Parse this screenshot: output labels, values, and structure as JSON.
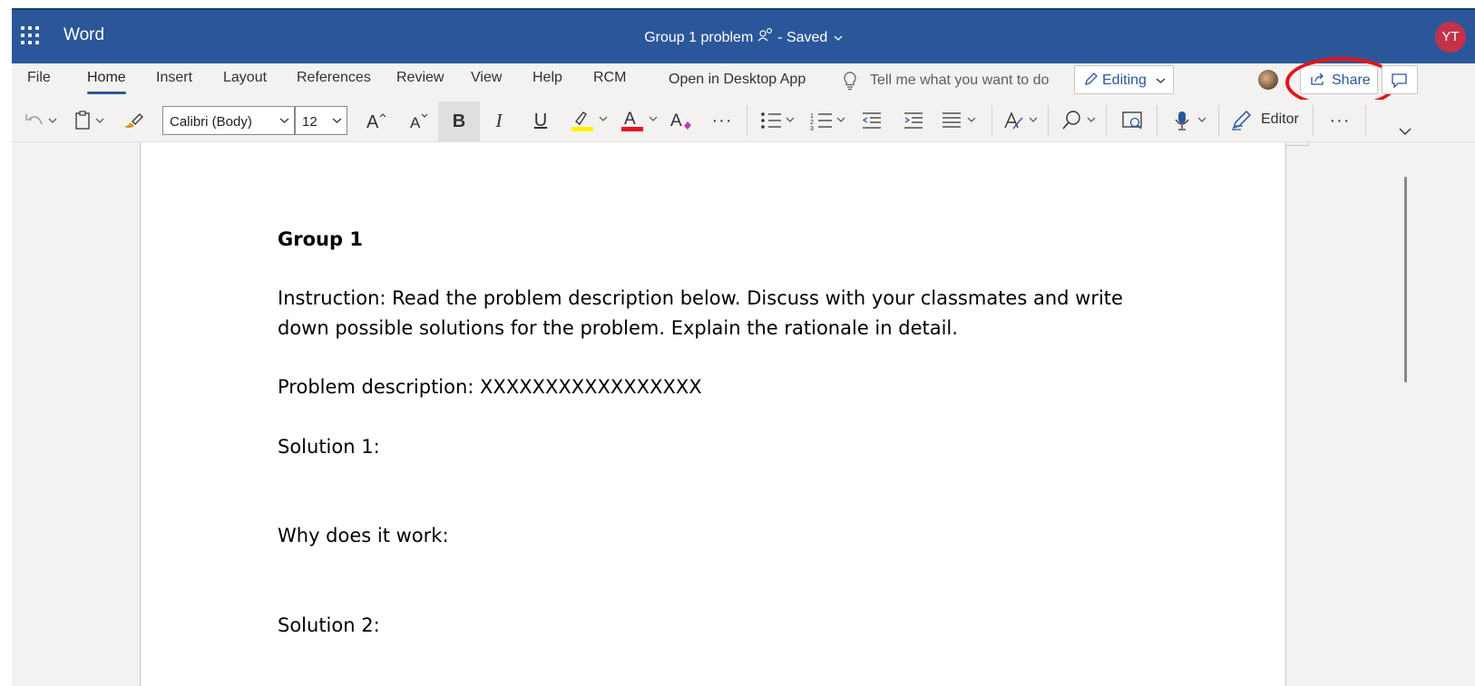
{
  "title_bar": {
    "app_name": "Word",
    "doc_title": "Group 1 problem",
    "saved_status": "- Saved",
    "user_initials": "YT"
  },
  "ribbon_tabs": [
    "File",
    "Home",
    "Insert",
    "Layout",
    "References",
    "Review",
    "View",
    "Help",
    "RCM",
    "Open in Desktop App"
  ],
  "active_tab": "Home",
  "tell_me_placeholder": "Tell me what you want to do",
  "editing_mode": "Editing",
  "share_label": "Share",
  "toolbar": {
    "font_name": "Calibri (Body)",
    "font_size": "12",
    "editor_label": "Editor",
    "highlight_color": "#fff100",
    "font_color": "#e81123"
  },
  "document": {
    "heading": "Group 1",
    "instruction_line1": "Instruction: Read the problem description below. Discuss with your classmates and write",
    "instruction_line2": "down possible solutions for the problem. Explain the rationale in detail.",
    "problem": "Problem description: XXXXXXXXXXXXXXXXX",
    "solution1": "Solution 1:",
    "why": "Why does it work:",
    "solution2": "Solution 2:"
  },
  "colors": {
    "titlebar": "#2b579a",
    "annotation_circle": "#e3141b",
    "avatar": "#c4314b"
  }
}
